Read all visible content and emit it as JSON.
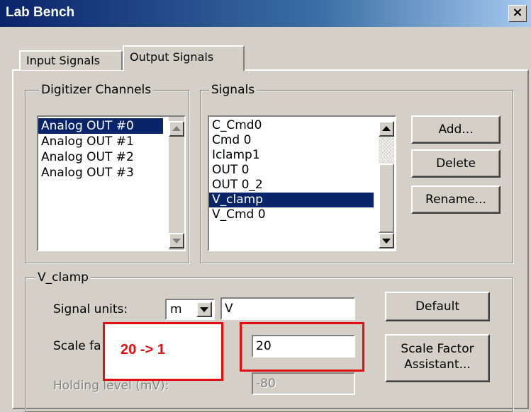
{
  "window": {
    "title": "Lab Bench",
    "close_glyph": "×"
  },
  "tabs": [
    {
      "label": "Input Signals",
      "active": false
    },
    {
      "label": "Output Signals",
      "active": true
    }
  ],
  "digitizer": {
    "legend": "Digitizer Channels",
    "items": [
      "Analog OUT #0",
      "Analog OUT #1",
      "Analog OUT #2",
      "Analog OUT #3"
    ],
    "selected": "Analog OUT #0"
  },
  "signals": {
    "legend": "Signals",
    "items": [
      "C_Cmd0",
      "Cmd 0",
      "Iclamp1",
      "OUT 0",
      "OUT 0_2",
      "V_clamp",
      "V_Cmd 0"
    ],
    "selected": "V_clamp"
  },
  "buttons": {
    "add": "Add...",
    "delete": "Delete",
    "rename": "Rename...",
    "default": "Default",
    "scale_factor_line1": "Scale Factor",
    "scale_factor_line2": "Assistant..."
  },
  "vclamp": {
    "legend": "V_clamp",
    "signal_units_label": "Signal units:",
    "prefix_value": "m",
    "units_value": "V",
    "scale_factor_label": "Scale fa",
    "scale_factor_value": "20",
    "holding_level_label": "Holding level (mV):",
    "holding_level_value": "-80"
  },
  "annotation": {
    "text": "20 -> 1",
    "color": "#e01010"
  }
}
